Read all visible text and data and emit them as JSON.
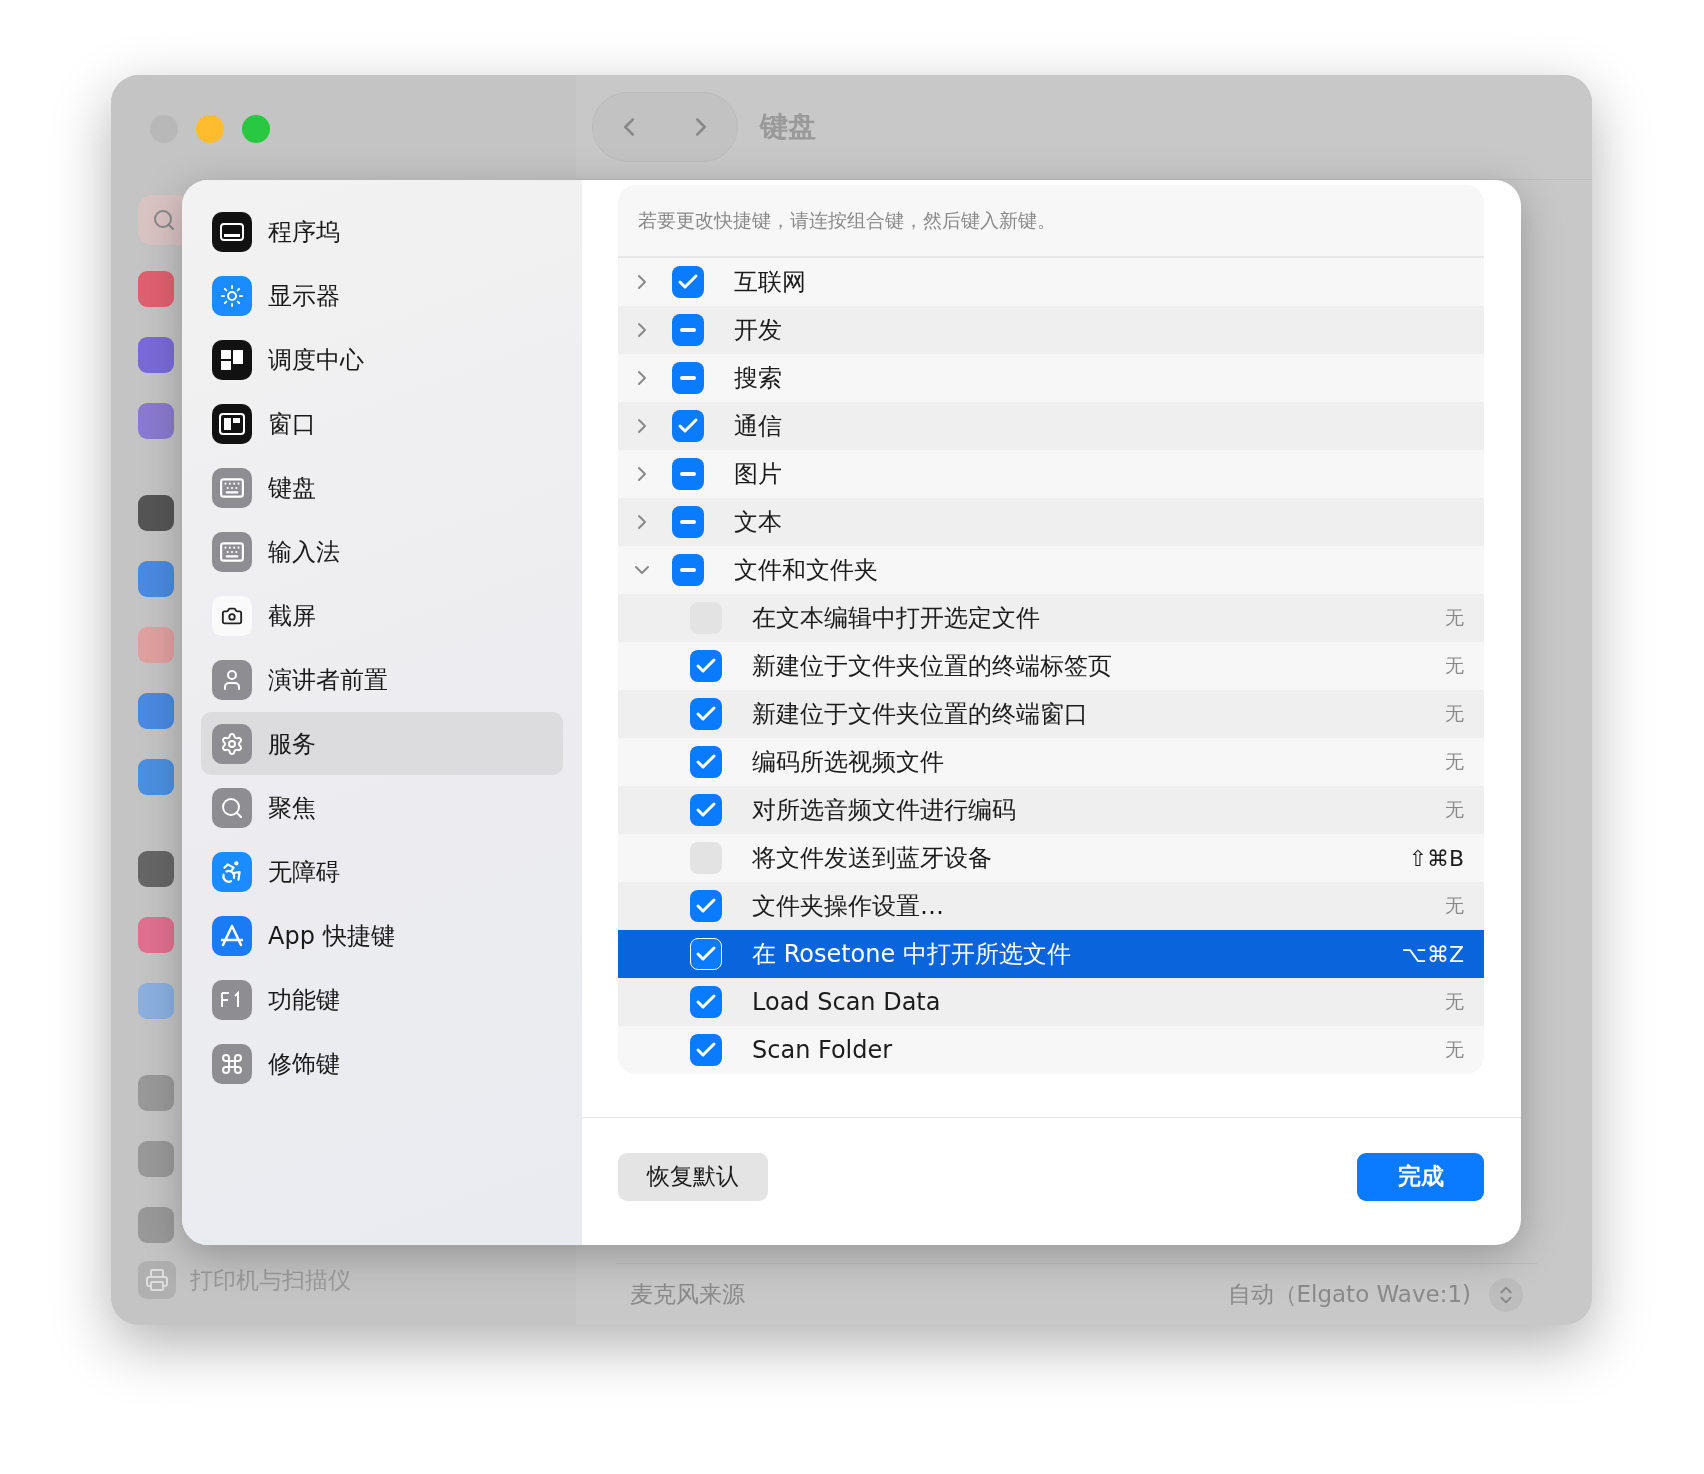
{
  "background_window": {
    "title": "键盘",
    "sidebar_footer_item": "打印机与扫描仪",
    "setting_row": {
      "label": "麦克风来源",
      "value": "自动（Elgato Wave:1)"
    }
  },
  "dialog": {
    "sidebar": {
      "items": [
        {
          "label": "程序坞",
          "selected": false
        },
        {
          "label": "显示器",
          "selected": false
        },
        {
          "label": "调度中心",
          "selected": false
        },
        {
          "label": "窗口",
          "selected": false
        },
        {
          "label": "键盘",
          "selected": false
        },
        {
          "label": "输入法",
          "selected": false
        },
        {
          "label": "截屏",
          "selected": false
        },
        {
          "label": "演讲者前置",
          "selected": false
        },
        {
          "label": "服务",
          "selected": true
        },
        {
          "label": "聚焦",
          "selected": false
        },
        {
          "label": "无障碍",
          "selected": false
        },
        {
          "label": "App 快捷键",
          "selected": false
        },
        {
          "label": "功能键",
          "selected": false
        },
        {
          "label": "修饰键",
          "selected": false
        }
      ]
    },
    "hint": "若要更改快捷键，请连按组合键，然后键入新键。",
    "groups": [
      {
        "label": "互联网",
        "checked": true,
        "mixed": false,
        "expanded": false
      },
      {
        "label": "开发",
        "checked": true,
        "mixed": true,
        "expanded": false
      },
      {
        "label": "搜索",
        "checked": true,
        "mixed": true,
        "expanded": false
      },
      {
        "label": "通信",
        "checked": true,
        "mixed": false,
        "expanded": false
      },
      {
        "label": "图片",
        "checked": true,
        "mixed": true,
        "expanded": false
      },
      {
        "label": "文本",
        "checked": true,
        "mixed": true,
        "expanded": false
      },
      {
        "label": "文件和文件夹",
        "checked": true,
        "mixed": true,
        "expanded": true,
        "children": [
          {
            "label": "在文本编辑中打开选定文件",
            "checked": false,
            "shortcut": "无",
            "assigned": false,
            "selected": false
          },
          {
            "label": "新建位于文件夹位置的终端标签页",
            "checked": true,
            "shortcut": "无",
            "assigned": false,
            "selected": false
          },
          {
            "label": "新建位于文件夹位置的终端窗口",
            "checked": true,
            "shortcut": "无",
            "assigned": false,
            "selected": false
          },
          {
            "label": "编码所选视频文件",
            "checked": true,
            "shortcut": "无",
            "assigned": false,
            "selected": false
          },
          {
            "label": "对所选音频文件进行编码",
            "checked": true,
            "shortcut": "无",
            "assigned": false,
            "selected": false
          },
          {
            "label": "将文件发送到蓝牙设备",
            "checked": false,
            "shortcut": "⇧⌘B",
            "assigned": true,
            "selected": false
          },
          {
            "label": "文件夹操作设置…",
            "checked": true,
            "shortcut": "无",
            "assigned": false,
            "selected": false
          },
          {
            "label": "在 Rosetone 中打开所选文件",
            "checked": true,
            "shortcut": "⌥⌘Z",
            "assigned": true,
            "selected": true
          },
          {
            "label": "Load Scan Data",
            "checked": true,
            "shortcut": "无",
            "assigned": false,
            "selected": false
          },
          {
            "label": "Scan Folder",
            "checked": true,
            "shortcut": "无",
            "assigned": false,
            "selected": false
          }
        ]
      }
    ],
    "buttons": {
      "restore": "恢复默认",
      "done": "完成"
    }
  }
}
